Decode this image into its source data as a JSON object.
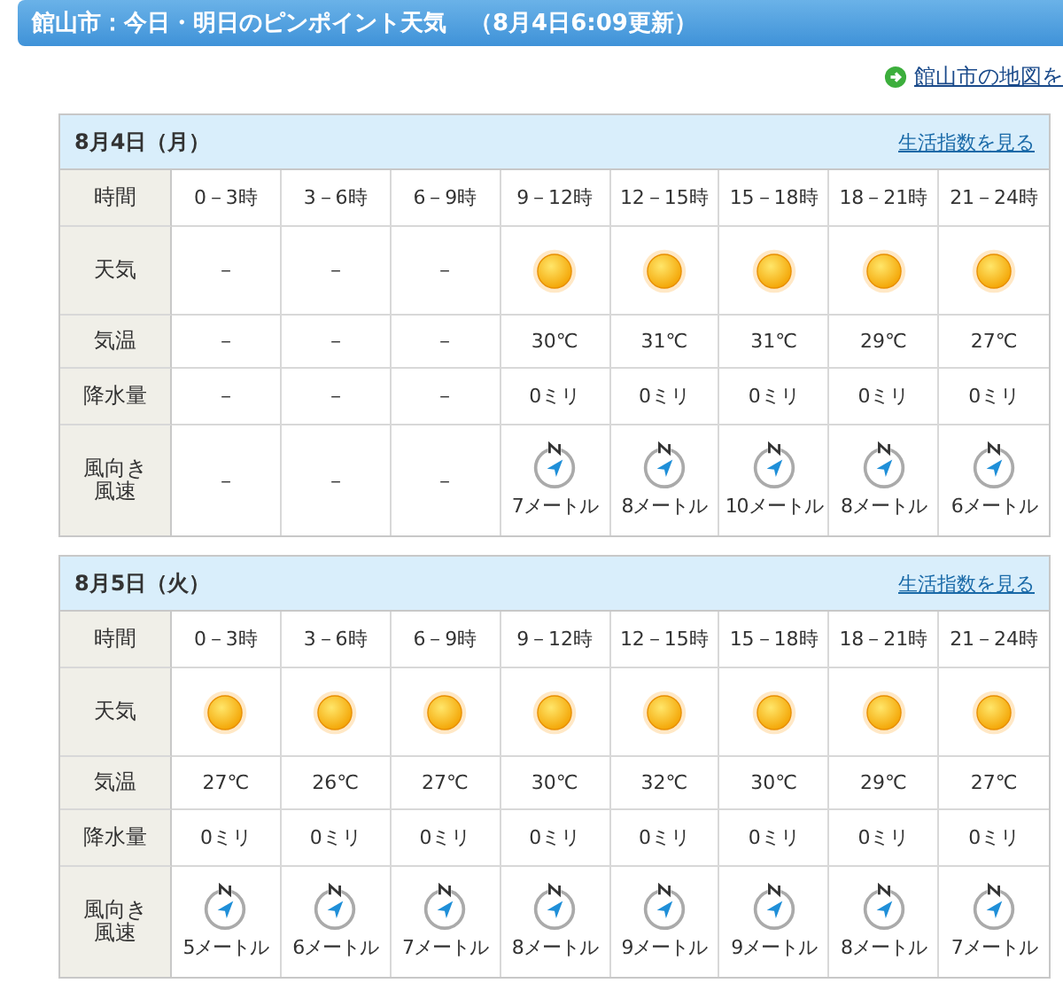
{
  "header": {
    "title": "館山市：今日・明日のピンポイント天気　（8月4日6:09更新）"
  },
  "map_link": {
    "label": "館山市の地図を"
  },
  "days": [
    {
      "date": "8月4日（月）",
      "link": "生活指数を見る",
      "row_labels": {
        "time": "時間",
        "weather": "天気",
        "temp": "気温",
        "rain": "降水量",
        "wind": [
          "風向き",
          "風速"
        ]
      },
      "slots": [
        {
          "time": "0－3時",
          "weather": {
            "kind": "text",
            "text": "－"
          },
          "temp": "－",
          "rain": "－",
          "wind": {
            "kind": "text",
            "text": "－"
          }
        },
        {
          "time": "3－6時",
          "weather": {
            "kind": "text",
            "text": "－"
          },
          "temp": "－",
          "rain": "－",
          "wind": {
            "kind": "text",
            "text": "－"
          }
        },
        {
          "time": "6－9時",
          "weather": {
            "kind": "text",
            "text": "－"
          },
          "temp": "－",
          "rain": "－",
          "wind": {
            "kind": "text",
            "text": "－"
          }
        },
        {
          "time": "9－12時",
          "weather": {
            "kind": "sunny"
          },
          "temp": "30℃",
          "rain": "0ミリ",
          "wind": {
            "kind": "compass",
            "text": "7メートル"
          }
        },
        {
          "time": "12－15時",
          "weather": {
            "kind": "sunny"
          },
          "temp": "31℃",
          "rain": "0ミリ",
          "wind": {
            "kind": "compass",
            "text": "8メートル"
          }
        },
        {
          "time": "15－18時",
          "weather": {
            "kind": "sunny"
          },
          "temp": "31℃",
          "rain": "0ミリ",
          "wind": {
            "kind": "compass",
            "text": "10メートル"
          }
        },
        {
          "time": "18－21時",
          "weather": {
            "kind": "sunny"
          },
          "temp": "29℃",
          "rain": "0ミリ",
          "wind": {
            "kind": "compass",
            "text": "8メートル"
          }
        },
        {
          "time": "21－24時",
          "weather": {
            "kind": "sunny"
          },
          "temp": "27℃",
          "rain": "0ミリ",
          "wind": {
            "kind": "compass",
            "text": "6メートル"
          }
        }
      ]
    },
    {
      "date": "8月5日（火）",
      "link": "生活指数を見る",
      "row_labels": {
        "time": "時間",
        "weather": "天気",
        "temp": "気温",
        "rain": "降水量",
        "wind": [
          "風向き",
          "風速"
        ]
      },
      "slots": [
        {
          "time": "0－3時",
          "weather": {
            "kind": "sunny"
          },
          "temp": "27℃",
          "rain": "0ミリ",
          "wind": {
            "kind": "compass",
            "text": "5メートル"
          }
        },
        {
          "time": "3－6時",
          "weather": {
            "kind": "sunny"
          },
          "temp": "26℃",
          "rain": "0ミリ",
          "wind": {
            "kind": "compass",
            "text": "6メートル"
          }
        },
        {
          "time": "6－9時",
          "weather": {
            "kind": "sunny"
          },
          "temp": "27℃",
          "rain": "0ミリ",
          "wind": {
            "kind": "compass",
            "text": "7メートル"
          }
        },
        {
          "time": "9－12時",
          "weather": {
            "kind": "sunny"
          },
          "temp": "30℃",
          "rain": "0ミリ",
          "wind": {
            "kind": "compass",
            "text": "8メートル"
          }
        },
        {
          "time": "12－15時",
          "weather": {
            "kind": "sunny"
          },
          "temp": "32℃",
          "rain": "0ミリ",
          "wind": {
            "kind": "compass",
            "text": "9メートル"
          }
        },
        {
          "time": "15－18時",
          "weather": {
            "kind": "sunny"
          },
          "temp": "30℃",
          "rain": "0ミリ",
          "wind": {
            "kind": "compass",
            "text": "9メートル"
          }
        },
        {
          "time": "18－21時",
          "weather": {
            "kind": "sunny"
          },
          "temp": "29℃",
          "rain": "0ミリ",
          "wind": {
            "kind": "compass",
            "text": "8メートル"
          }
        },
        {
          "time": "21－24時",
          "weather": {
            "kind": "sunny"
          },
          "temp": "27℃",
          "rain": "0ミリ",
          "wind": {
            "kind": "compass",
            "text": "7メートル"
          }
        }
      ]
    }
  ]
}
